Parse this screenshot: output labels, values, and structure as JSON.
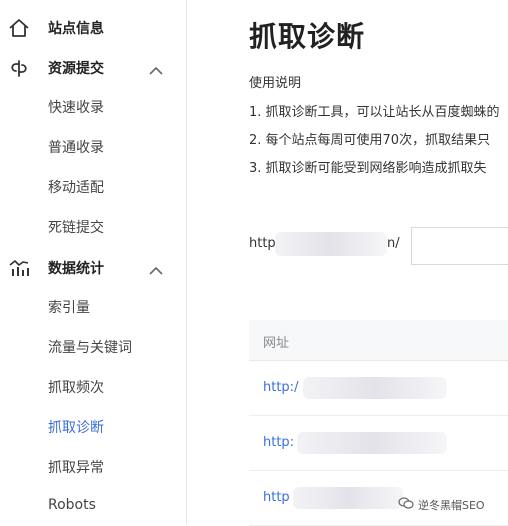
{
  "sidebar": {
    "site_info": {
      "label": "站点信息",
      "icon": "home-icon"
    },
    "resource_submit": {
      "label": "资源提交",
      "icon": "link-icon",
      "items": [
        {
          "label": "快速收录"
        },
        {
          "label": "普通收录"
        },
        {
          "label": "移动适配"
        },
        {
          "label": "死链提交"
        }
      ]
    },
    "data_stats": {
      "label": "数据统计",
      "icon": "chart-icon",
      "items": [
        {
          "label": "索引量"
        },
        {
          "label": "流量与关键词"
        },
        {
          "label": "抓取频次"
        },
        {
          "label": "抓取诊断",
          "active": true
        },
        {
          "label": "抓取异常"
        },
        {
          "label": "Robots"
        }
      ]
    }
  },
  "main": {
    "title": "抓取诊断",
    "usage_heading": "使用说明",
    "instructions": [
      "1. 抓取诊断工具，可以让站长从百度蜘蛛的",
      "2. 每个站点每周可使用70次，抓取结果只",
      "3. 抓取诊断可能受到网络影响造成抓取失"
    ],
    "url_prefix": "http",
    "url_suffix": "n/",
    "table": {
      "header": "网址",
      "rows": [
        {
          "url": "http:/"
        },
        {
          "url": "http:"
        },
        {
          "url": "http"
        }
      ]
    }
  },
  "watermark": {
    "text": "逆冬黑帽SEO"
  },
  "colors": {
    "accent": "#3a6fd8",
    "border": "#e8e8e8"
  }
}
